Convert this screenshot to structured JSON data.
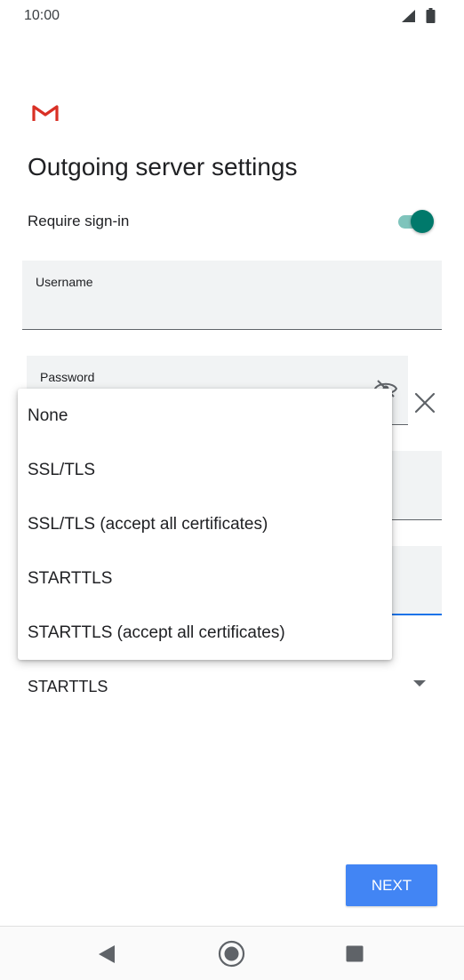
{
  "status_bar": {
    "time": "10:00"
  },
  "header": {
    "title": "Outgoing server settings"
  },
  "require_signin": {
    "label": "Require sign-in",
    "enabled": true
  },
  "fields": {
    "username_label": "Username",
    "password_label": "Password"
  },
  "security": {
    "selected": "STARTTLS",
    "options": [
      "None",
      "SSL/TLS",
      "SSL/TLS (accept all certificates)",
      "STARTTLS",
      "STARTTLS (accept all certificates)"
    ]
  },
  "actions": {
    "next_label": "NEXT"
  },
  "colors": {
    "accent": "#4285f4",
    "toggle_on": "#00796b",
    "gmail_red": "#d93025"
  },
  "icons": [
    "signal-icon",
    "battery-icon",
    "gmail-icon",
    "visibility-off-icon",
    "close-icon",
    "dropdown-arrow-icon",
    "back-icon",
    "home-icon",
    "recents-icon"
  ]
}
